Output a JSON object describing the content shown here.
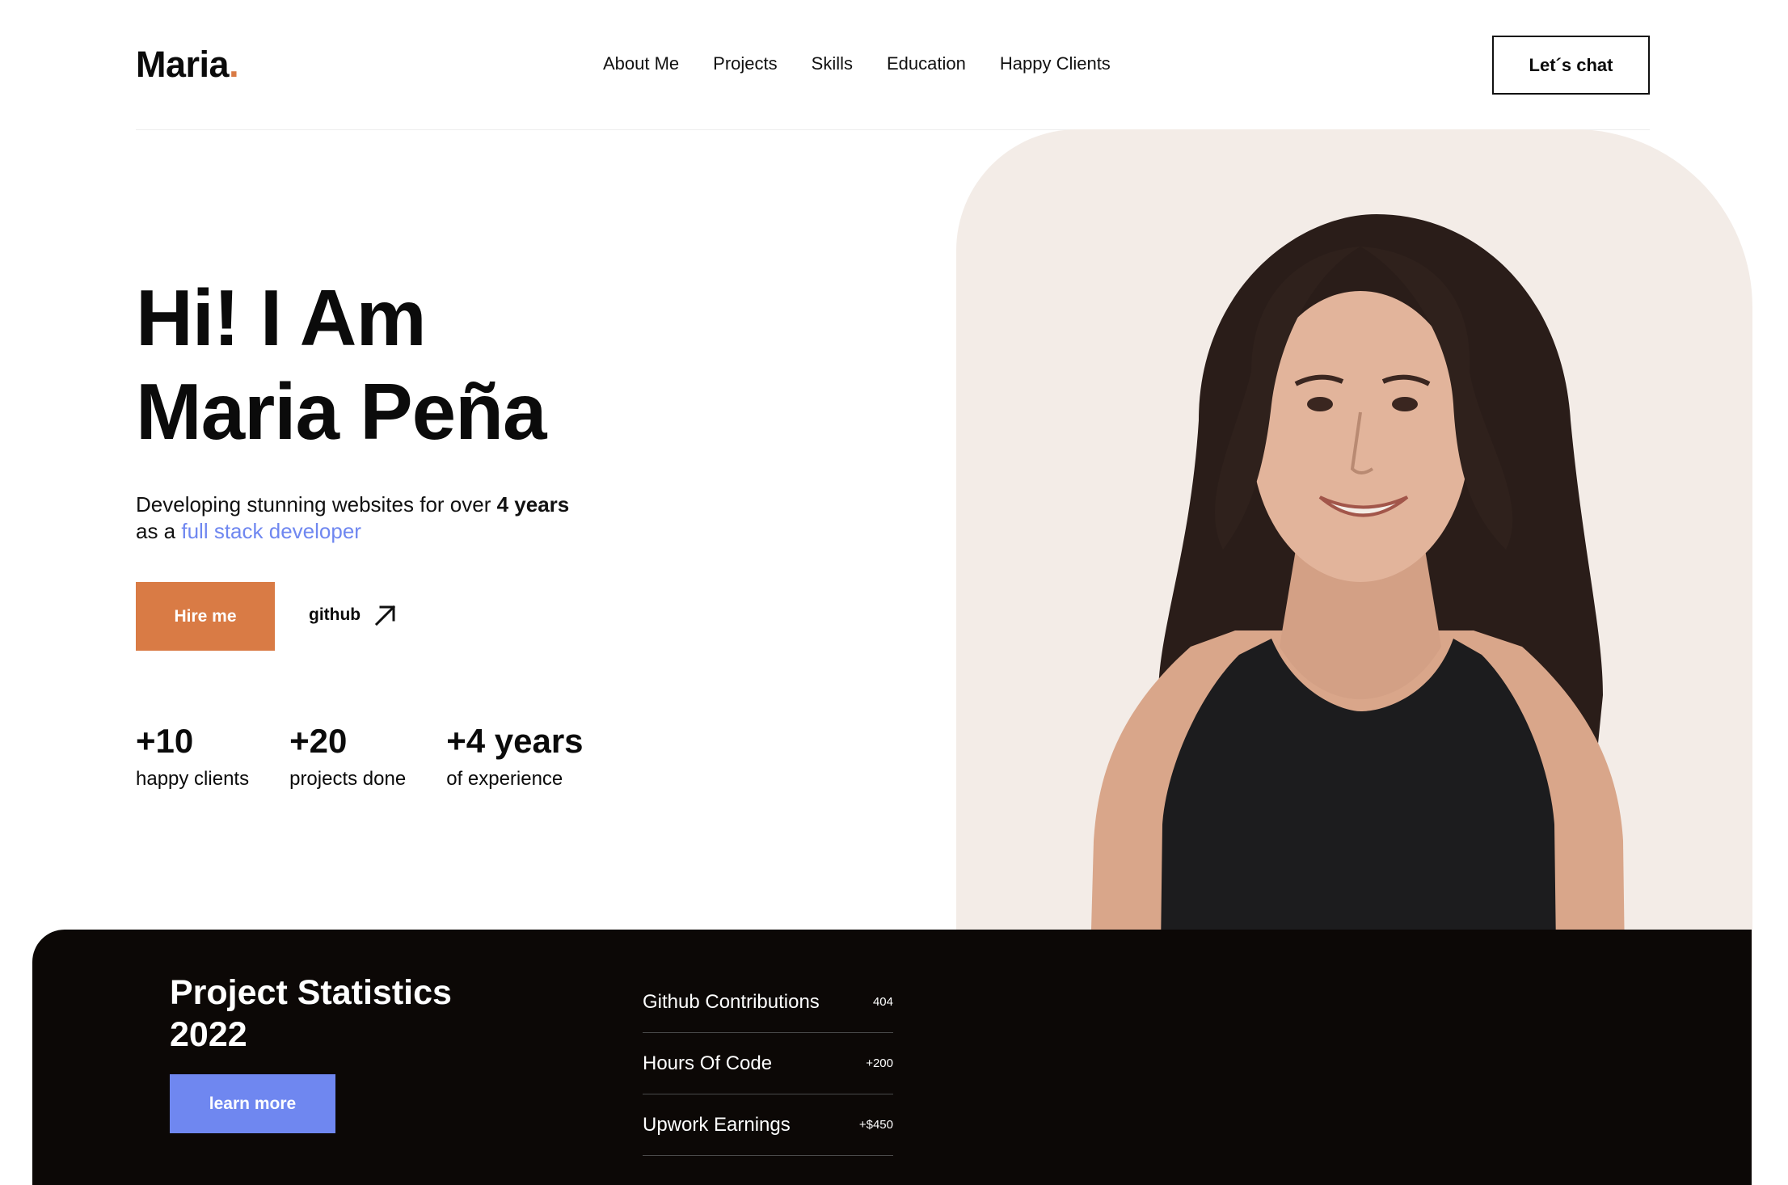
{
  "header": {
    "logo_text": "Maria",
    "logo_dot": ".",
    "nav": [
      "About Me",
      "Projects",
      "Skills",
      "Education",
      "Happy Clients"
    ],
    "cta_label": "Let´s chat"
  },
  "hero": {
    "title_line1": "Hi! I Am",
    "title_line2": "Maria Peña",
    "subtitle_pre": "Developing stunning websites for over ",
    "subtitle_bold": "4 years",
    "subtitle_mid": "as a ",
    "subtitle_accent": "full stack developer",
    "hire_label": "Hire me",
    "github_label": "github",
    "stats": [
      {
        "num": "+10",
        "caption": "happy clients"
      },
      {
        "num": "+20",
        "caption": "projects done"
      },
      {
        "num": "+4 years",
        "caption": "of experience"
      }
    ]
  },
  "project_stats": {
    "title": "Project Statistics 2022",
    "learn_label": "learn more",
    "rows": [
      {
        "key": "Github Contributions",
        "value": "404"
      },
      {
        "key": "Hours Of Code",
        "value": "+200"
      },
      {
        "key": "Upwork Earnings",
        "value": "+$450"
      }
    ]
  },
  "colors": {
    "accent_orange": "#d97b45",
    "accent_blue": "#6f87f0",
    "dark_panel": "#0c0806",
    "portrait_bg": "#f3ece7"
  }
}
